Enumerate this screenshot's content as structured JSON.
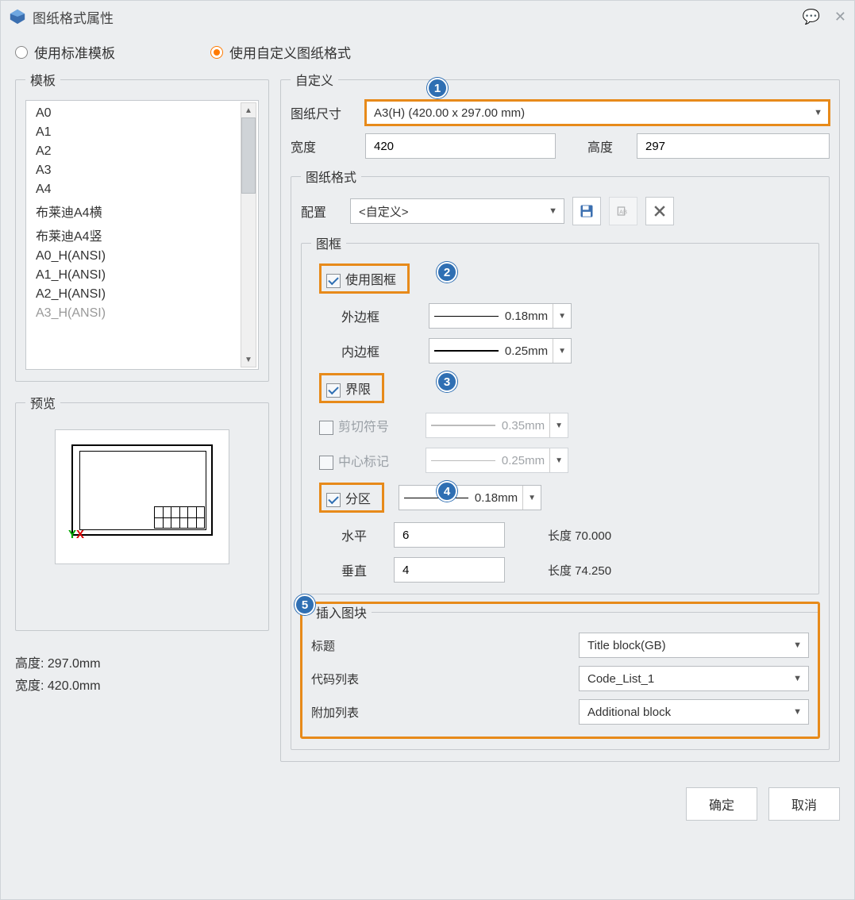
{
  "title": "图纸格式属性",
  "radios": {
    "standard": "使用标准模板",
    "custom": "使用自定义图纸格式"
  },
  "templates": {
    "legend": "模板",
    "items": [
      "A0",
      "A1",
      "A2",
      "A3",
      "A4",
      "布莱迪A4横",
      "布莱迪A4竖",
      "A0_H(ANSI)",
      "A1_H(ANSI)",
      "A2_H(ANSI)",
      "A3_H(ANSI)"
    ]
  },
  "preview": {
    "legend": "预览",
    "height_label": "高度: 297.0mm",
    "width_label": "宽度: 420.0mm"
  },
  "custom": {
    "legend": "自定义",
    "size_label": "图纸尺寸",
    "size_value": "A3(H) (420.00 x 297.00 mm)",
    "width_label": "宽度",
    "width_value": "420",
    "height_label": "高度",
    "height_value": "297"
  },
  "format": {
    "legend": "图纸格式",
    "config_label": "配置",
    "config_value": "<自定义>",
    "frame": {
      "legend": "图框",
      "use_frame": "使用图框",
      "outer_label": "外边框",
      "outer_value": "0.18mm",
      "inner_label": "内边框",
      "inner_value": "0.25mm",
      "limit": "界限",
      "trim_label": "剪切符号",
      "trim_value": "0.35mm",
      "center_label": "中心标记",
      "center_value": "0.25mm",
      "zone": "分区",
      "zone_value": "0.18mm",
      "horiz_label": "水平",
      "horiz_value": "6",
      "horiz_len_label": "长度 70.000",
      "vert_label": "垂直",
      "vert_value": "4",
      "vert_len_label": "长度 74.250"
    },
    "block": {
      "legend": "插入图块",
      "title_label": "标题",
      "title_value": "Title block(GB)",
      "code_label": "代码列表",
      "code_value": "Code_List_1",
      "add_label": "附加列表",
      "add_value": "Additional block"
    }
  },
  "callouts": {
    "c1": "1",
    "c2": "2",
    "c3": "3",
    "c4": "4",
    "c5": "5"
  },
  "buttons": {
    "ok": "确定",
    "cancel": "取消"
  }
}
